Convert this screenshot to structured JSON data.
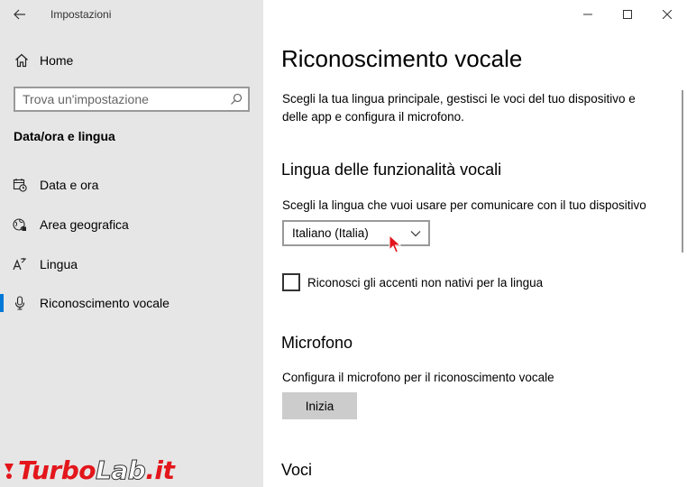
{
  "window": {
    "title": "Impostazioni"
  },
  "sidebar": {
    "home_label": "Home",
    "search_placeholder": "Trova un'impostazione",
    "section_title": "Data/ora e lingua",
    "items": [
      {
        "label": "Data e ora",
        "icon": "calendar-clock-icon"
      },
      {
        "label": "Area geografica",
        "icon": "globe-icon"
      },
      {
        "label": "Lingua",
        "icon": "language-icon"
      },
      {
        "label": "Riconoscimento vocale",
        "icon": "microphone-icon",
        "selected": true
      }
    ]
  },
  "main": {
    "title": "Riconoscimento vocale",
    "intro": "Scegli la tua lingua principale, gestisci le voci del tuo dispositivo e delle app e configura il microfono.",
    "language_section": {
      "heading": "Lingua delle funzionalità vocali",
      "description": "Scegli la lingua che vuoi usare per comunicare con il tuo dispositivo",
      "selected_language": "Italiano (Italia)",
      "checkbox_label": "Riconosci gli accenti non nativi per la lingua",
      "checkbox_checked": false
    },
    "microphone_section": {
      "heading": "Microfono",
      "description": "Configura il microfono per il riconoscimento vocale",
      "button_label": "Inizia"
    },
    "voices_section": {
      "heading": "Voci"
    }
  },
  "watermark": {
    "part1": "Turbo",
    "part2": "Lab",
    "part3": ".it"
  },
  "colors": {
    "accent": "#0078d7",
    "sidebar_bg": "#e6e6e6",
    "button_bg": "#cccccc",
    "watermark_red": "#e3161b"
  }
}
